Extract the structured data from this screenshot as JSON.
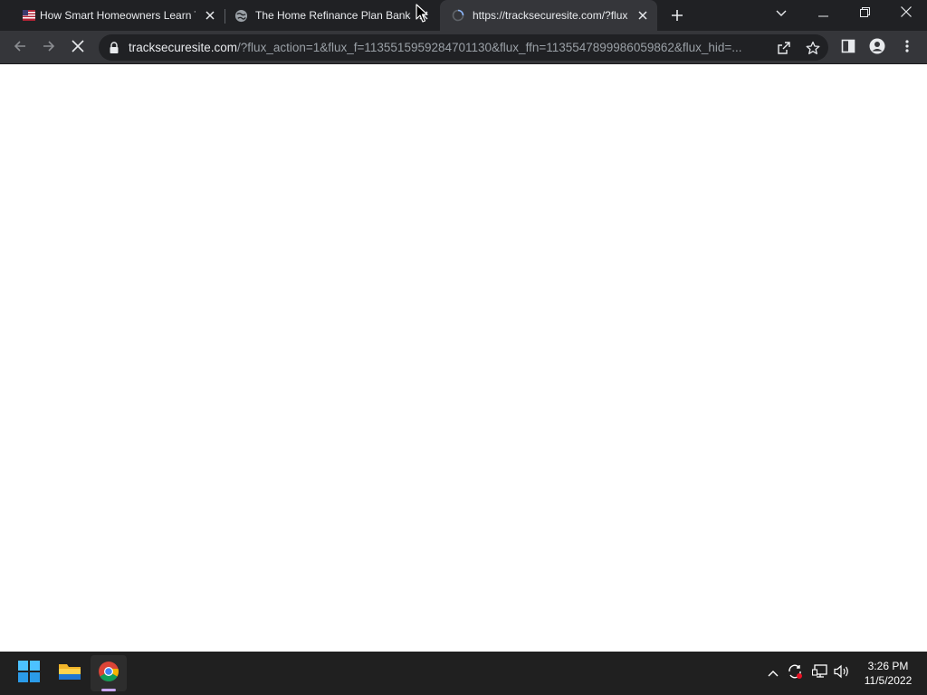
{
  "browser": {
    "tabs": [
      {
        "title": "How Smart Homeowners Learn T",
        "favicon": "flag-icon",
        "active": false
      },
      {
        "title": "The Home Refinance Plan Banks",
        "favicon": "globe-icon",
        "active": false
      },
      {
        "title": "https://tracksecuresite.com/?flux",
        "favicon": "loading-spinner-icon",
        "active": true
      }
    ],
    "address_bar": {
      "host": "tracksecuresite.com",
      "path": "/?flux_action=1&flux_f=1135515959284701130&flux_ffn=1135547899986059862&flux_hid=..."
    },
    "loading": true
  },
  "taskbar": {
    "apps": [
      "start-icon",
      "file-explorer-icon",
      "chrome-icon"
    ],
    "clock": {
      "time": "3:26 PM",
      "date": "11/5/2022"
    }
  },
  "colors": {
    "tabstrip_bg": "#202124",
    "toolbar_bg": "#35363a",
    "omnibox_bg": "#202124",
    "taskbar_bg": "#202020",
    "accent": "#c8a6f0"
  }
}
